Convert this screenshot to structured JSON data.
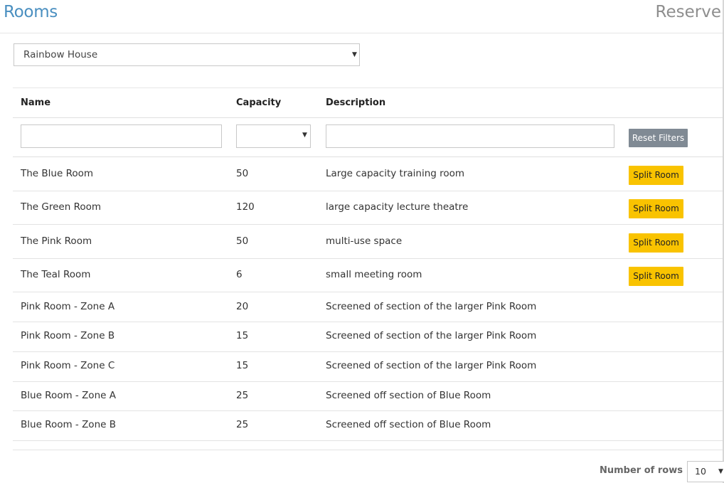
{
  "header": {
    "title": "Rooms",
    "reserve": "Reserve"
  },
  "building_select": {
    "value": "Rainbow House"
  },
  "table": {
    "columns": [
      "Name",
      "Capacity",
      "Description"
    ],
    "reset_label": "Reset Filters",
    "split_label": "Split Room",
    "rows": [
      {
        "name": "The Blue Room",
        "capacity": "50",
        "description": "Large capacity training room",
        "split": true
      },
      {
        "name": "The Green Room",
        "capacity": "120",
        "description": "large capacity lecture theatre",
        "split": true
      },
      {
        "name": "The Pink Room",
        "capacity": "50",
        "description": "multi-use space",
        "split": true
      },
      {
        "name": "The Teal Room",
        "capacity": "6",
        "description": "small meeting room",
        "split": true
      },
      {
        "name": "Pink Room - Zone A",
        "capacity": "20",
        "description": "Screened of section of the larger Pink Room",
        "split": false
      },
      {
        "name": "Pink Room - Zone B",
        "capacity": "15",
        "description": "Screened of section of the larger Pink Room",
        "split": false
      },
      {
        "name": "Pink Room - Zone C",
        "capacity": "15",
        "description": "Screened of section of the larger Pink Room",
        "split": false
      },
      {
        "name": "Blue Room - Zone A",
        "capacity": "25",
        "description": "Screened off section of Blue Room",
        "split": false
      },
      {
        "name": "Blue Room - Zone B",
        "capacity": "25",
        "description": "Screened off section of Blue Room",
        "split": false
      }
    ]
  },
  "pagination": {
    "rows_label": "Number of rows",
    "rows_value": "10"
  }
}
